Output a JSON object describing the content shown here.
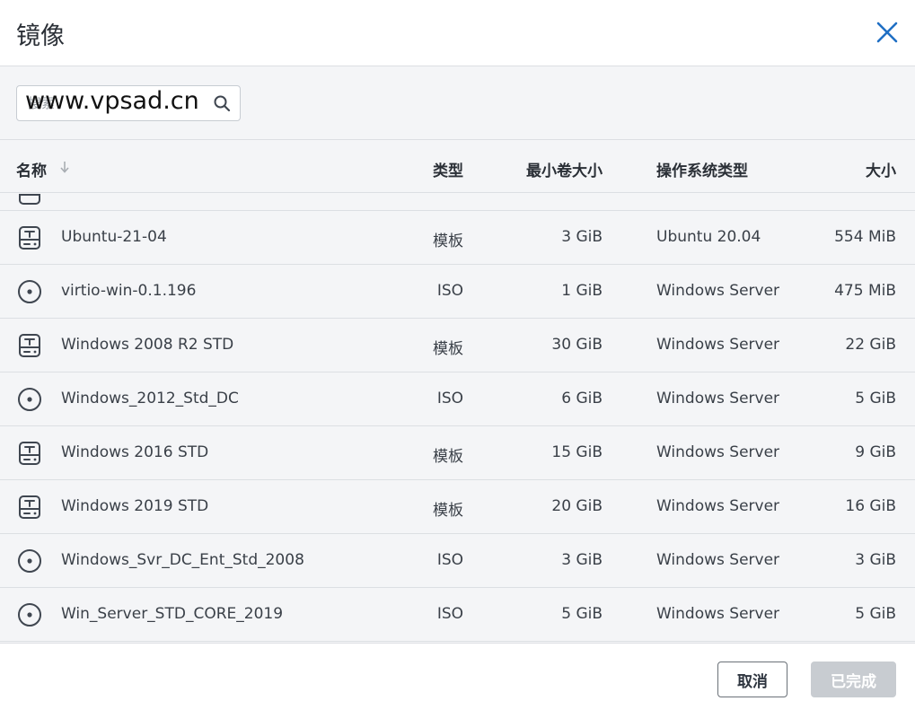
{
  "dialog": {
    "title": "镜像"
  },
  "search": {
    "placeholder": "搜索",
    "value": ""
  },
  "watermark": "www.vpsad.cn",
  "table": {
    "columns": {
      "name": "名称",
      "type": "类型",
      "min_volume": "最小卷大小",
      "os_type": "操作系统类型",
      "size": "大小"
    },
    "rows": [
      {
        "icon": "template-drive-icon",
        "name": "Ubuntu-21-04",
        "type": "模板",
        "min_volume": "3 GiB",
        "os_type": "Ubuntu 20.04",
        "size": "554 MiB"
      },
      {
        "icon": "iso-disc-icon",
        "name": "virtio-win-0.1.196",
        "type": "ISO",
        "min_volume": "1 GiB",
        "os_type": "Windows Server",
        "size": "475 MiB"
      },
      {
        "icon": "template-drive-icon",
        "name": "Windows 2008 R2 STD",
        "type": "模板",
        "min_volume": "30 GiB",
        "os_type": "Windows Server",
        "size": "22 GiB"
      },
      {
        "icon": "iso-disc-icon",
        "name": "Windows_2012_Std_DC",
        "type": "ISO",
        "min_volume": "6 GiB",
        "os_type": "Windows Server",
        "size": "5 GiB"
      },
      {
        "icon": "template-drive-icon",
        "name": "Windows 2016 STD",
        "type": "模板",
        "min_volume": "15 GiB",
        "os_type": "Windows Server",
        "size": "9 GiB"
      },
      {
        "icon": "template-drive-icon",
        "name": "Windows 2019 STD",
        "type": "模板",
        "min_volume": "20 GiB",
        "os_type": "Windows Server",
        "size": "16 GiB"
      },
      {
        "icon": "iso-disc-icon",
        "name": "Windows_Svr_DC_Ent_Std_2008",
        "type": "ISO",
        "min_volume": "3 GiB",
        "os_type": "Windows Server",
        "size": "3 GiB"
      },
      {
        "icon": "iso-disc-icon",
        "name": "Win_Server_STD_CORE_2019",
        "type": "ISO",
        "min_volume": "5 GiB",
        "os_type": "Windows Server",
        "size": "5 GiB"
      }
    ]
  },
  "footer": {
    "cancel_label": "取消",
    "done_label": "已完成"
  },
  "colors": {
    "accent": "#1f6fc4",
    "disabled_button": "#c8ccd1",
    "icon": "#3f4650"
  }
}
